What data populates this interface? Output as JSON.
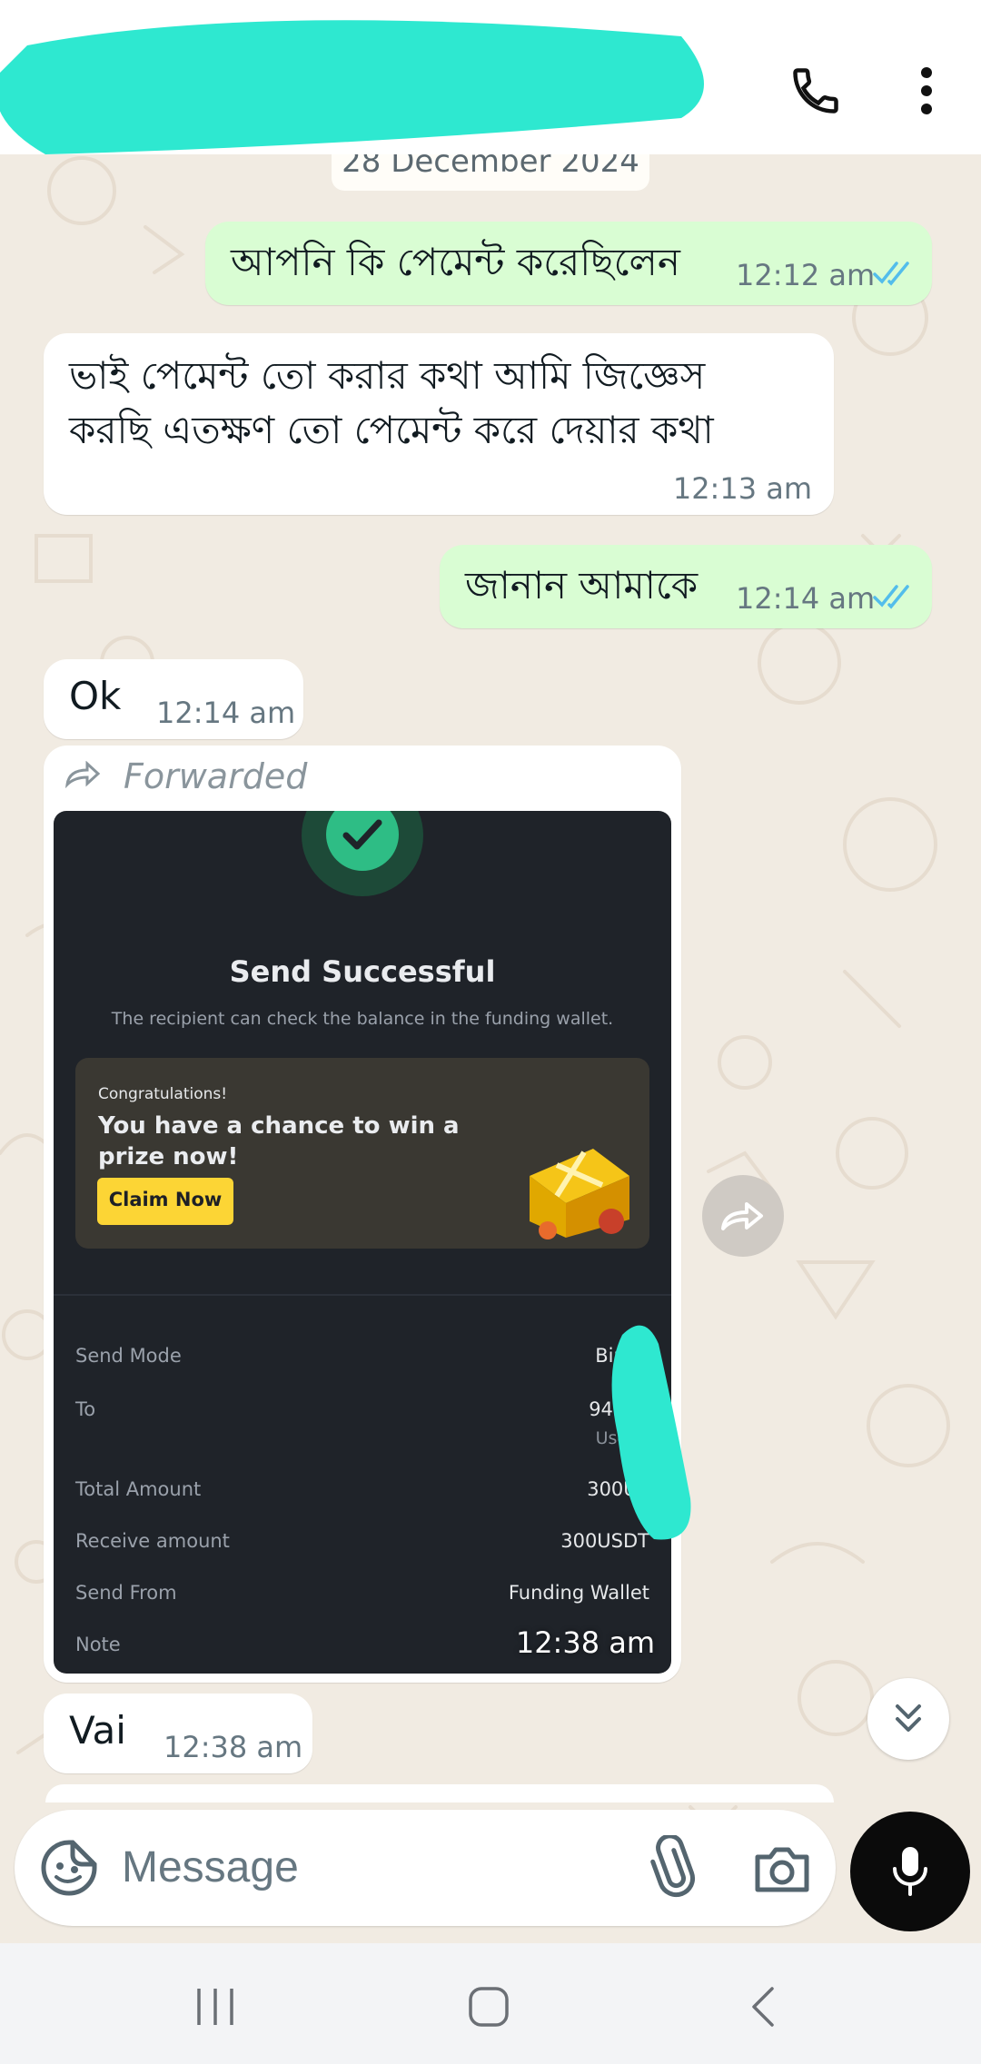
{
  "header": {
    "call_icon": "phone-icon",
    "menu_icon": "more-vert-icon",
    "redaction_color": "#2ee8d0"
  },
  "date_chip": "28 December 2024",
  "messages": [
    {
      "direction": "out",
      "text": "আপনি কি পেমেন্ট করেছিলেন",
      "time": "12:12 am",
      "status": "read"
    },
    {
      "direction": "in",
      "lines": [
        "ভাই পেমেন্ট তো করার কথা আমি জিজ্ঞেস",
        "করছি এতক্ষণ তো পেমেন্ট করে দেয়ার কথা"
      ],
      "time": "12:13 am"
    },
    {
      "direction": "out",
      "text": "জানান আমাকে",
      "time": "12:14 am",
      "status": "read"
    },
    {
      "direction": "in",
      "text": "Ok",
      "time": "12:14 am"
    },
    {
      "direction": "in",
      "forwarded_label": "Forwarded",
      "time": "12:38 am",
      "screenshot": {
        "title": "Send Successful",
        "subtitle": "The recipient can check the balance in the funding wallet.",
        "promo_kicker": "Congratulations!",
        "promo_headline": "You have a chance to win a prize now!",
        "promo_button": "Claim Now",
        "rows": [
          {
            "label": "Send Mode",
            "value": "Binan"
          },
          {
            "label": "To",
            "value": "94230",
            "sub": "User-c"
          },
          {
            "label": "Total Amount",
            "value": "300US"
          },
          {
            "label": "Receive amount",
            "value": "300USDT"
          },
          {
            "label": "Send From",
            "value": "Funding Wallet"
          },
          {
            "label": "Note",
            "value": ""
          }
        ]
      }
    },
    {
      "direction": "in",
      "text": "Vai",
      "time": "12:38 am"
    }
  ],
  "composer": {
    "placeholder": "Message",
    "emoji_icon": "sticker-icon",
    "attach_icon": "paperclip-icon",
    "camera_icon": "camera-icon",
    "mic_icon": "mic-icon"
  },
  "colors": {
    "outgoing_bubble": "#d9fdd3",
    "incoming_bubble": "#ffffff",
    "read_ticks": "#53bdeb",
    "binance_yellow": "#fcd535",
    "success_green": "#2ebd85"
  }
}
